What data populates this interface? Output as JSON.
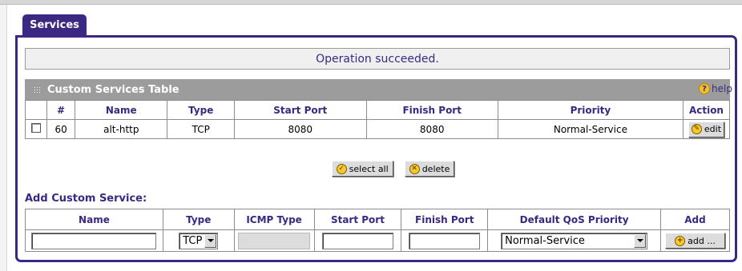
{
  "tab": {
    "label": "Services"
  },
  "status": {
    "message": "Operation succeeded."
  },
  "custom_table": {
    "title": "Custom Services Table",
    "help_label": "help",
    "headers": [
      "#",
      "Name",
      "Type",
      "Start Port",
      "Finish Port",
      "Priority",
      "Action"
    ],
    "rows": [
      {
        "num": "60",
        "name": "alt-http",
        "type": "TCP",
        "start_port": "8080",
        "finish_port": "8080",
        "priority": "Normal-Service",
        "action_label": "edit",
        "checked": false
      }
    ]
  },
  "buttons": {
    "select_all": "select all",
    "delete": "delete"
  },
  "add_service": {
    "title": "Add Custom Service:",
    "headers": [
      "Name",
      "Type",
      "ICMP Type",
      "Start Port",
      "Finish Port",
      "Default QoS Priority",
      "Add"
    ],
    "type_selected": "TCP",
    "priority_selected": "Normal-Service",
    "add_label": "add ..."
  },
  "colors": {
    "accent": "#3a2883",
    "section_bar": "#9c9c9c",
    "icon_yellow": "#f7c92a"
  },
  "icons": [
    "grip-icon",
    "help-icon",
    "edit-icon",
    "check-icon",
    "delete-icon",
    "add-icon",
    "dropdown-arrow-icon"
  ]
}
